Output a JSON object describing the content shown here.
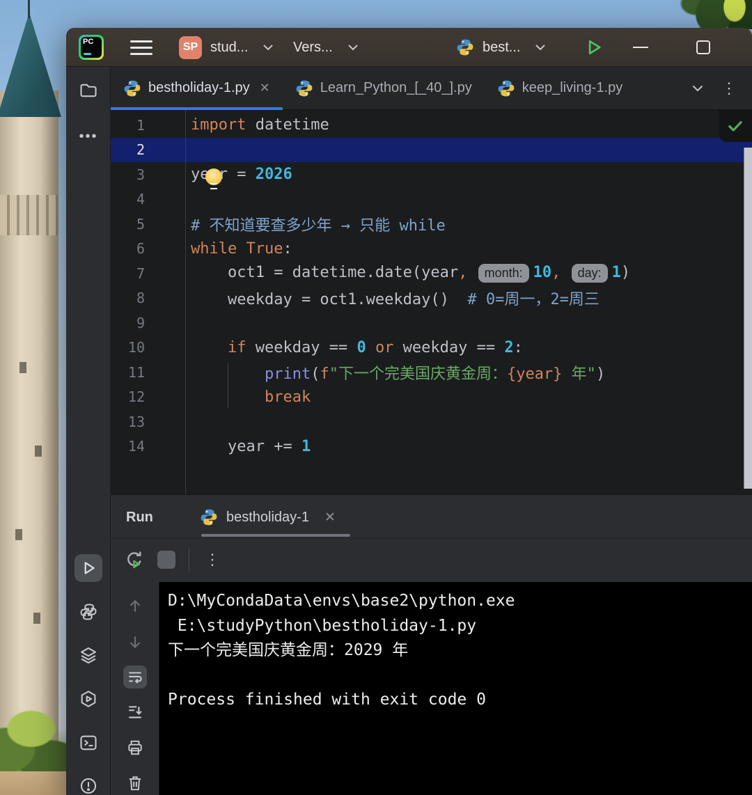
{
  "colors": {
    "accent_blue": "#3574F0",
    "run_green": "#4CC361",
    "inspection_green": "#57A85C",
    "sp_badge": "#E0836A",
    "caret_line_blue": "#13206E",
    "console_bg": "#000000"
  },
  "titlebar": {
    "logo_text": "PC",
    "project_badge": "SP",
    "project_selector": "stud...",
    "vcs_selector": "Vers...",
    "run_config_selector": "best..."
  },
  "editor_tabs": {
    "tabs": [
      {
        "label": "bestholiday-1.py",
        "active": true,
        "close": "✕"
      },
      {
        "label": "Learn_Python_[_40_].py",
        "active": false,
        "close": ""
      },
      {
        "label": "keep_living-1.py",
        "active": false,
        "close": ""
      }
    ]
  },
  "editor": {
    "lines": [
      {
        "n": "1",
        "tokens": [
          {
            "s": "kw",
            "t": "import"
          },
          {
            "s": "t",
            "t": " datetime"
          }
        ]
      },
      {
        "n": "2",
        "caret": true,
        "tokens": []
      },
      {
        "n": "3",
        "tokens": [
          {
            "s": "t",
            "t": "year = "
          },
          {
            "s": "num",
            "t": "2026"
          }
        ]
      },
      {
        "n": "4",
        "tokens": []
      },
      {
        "n": "5",
        "tokens": [
          {
            "s": "com",
            "t": "# 不知道要查多少年 → 只能 while"
          }
        ]
      },
      {
        "n": "6",
        "tokens": [
          {
            "s": "kw",
            "t": "while"
          },
          {
            "s": "t",
            "t": " "
          },
          {
            "s": "kw",
            "t": "True"
          },
          {
            "s": "t",
            "t": ":"
          }
        ]
      },
      {
        "n": "7",
        "tokens": [
          {
            "s": "t",
            "t": "    oct1 = datetime.date(year"
          },
          {
            "s": "kw",
            "t": ","
          },
          {
            "s": "t",
            "t": " "
          },
          {
            "s": "inlay",
            "t": "month:"
          },
          {
            "s": "num",
            "t": "10"
          },
          {
            "s": "kw",
            "t": ","
          },
          {
            "s": "t",
            "t": " "
          },
          {
            "s": "inlay",
            "t": "day:"
          },
          {
            "s": "num",
            "t": "1"
          },
          {
            "s": "t",
            "t": ")"
          }
        ]
      },
      {
        "n": "8",
        "tokens": [
          {
            "s": "t",
            "t": "    weekday = oct1.weekday()  "
          },
          {
            "s": "com",
            "t": "# 0=周一，2=周三"
          }
        ]
      },
      {
        "n": "9",
        "tokens": []
      },
      {
        "n": "10",
        "tokens": [
          {
            "s": "t",
            "t": "    "
          },
          {
            "s": "kw",
            "t": "if"
          },
          {
            "s": "t",
            "t": " weekday == "
          },
          {
            "s": "num",
            "t": "0"
          },
          {
            "s": "t",
            "t": " "
          },
          {
            "s": "kw",
            "t": "or"
          },
          {
            "s": "t",
            "t": " weekday == "
          },
          {
            "s": "num",
            "t": "2"
          },
          {
            "s": "t",
            "t": ":"
          }
        ]
      },
      {
        "n": "11",
        "tokens": [
          {
            "s": "t",
            "t": "        "
          },
          {
            "s": "builtin",
            "t": "print"
          },
          {
            "s": "t",
            "t": "("
          },
          {
            "s": "kw",
            "t": "f"
          },
          {
            "s": "str",
            "t": "\"下一个完美国庆黄金周："
          },
          {
            "s": "kw",
            "t": "{year}"
          },
          {
            "s": "str",
            "t": " 年\""
          },
          {
            "s": "t",
            "t": ")"
          }
        ]
      },
      {
        "n": "12",
        "tokens": [
          {
            "s": "t",
            "t": "        "
          },
          {
            "s": "kw",
            "t": "break"
          }
        ]
      },
      {
        "n": "13",
        "tokens": []
      },
      {
        "n": "14",
        "tokens": [
          {
            "s": "t",
            "t": "    year += "
          },
          {
            "s": "num",
            "t": "1"
          }
        ]
      }
    ]
  },
  "run_panel": {
    "title": "Run",
    "tab_label": "bestholiday-1",
    "tab_close": "✕"
  },
  "console": {
    "lines": [
      "D:\\MyCondaData\\envs\\base2\\python.exe",
      " E:\\studyPython\\bestholiday-1.py",
      "下一个完美国庆黄金周：2029 年",
      "",
      "Process finished with exit code 0"
    ]
  }
}
